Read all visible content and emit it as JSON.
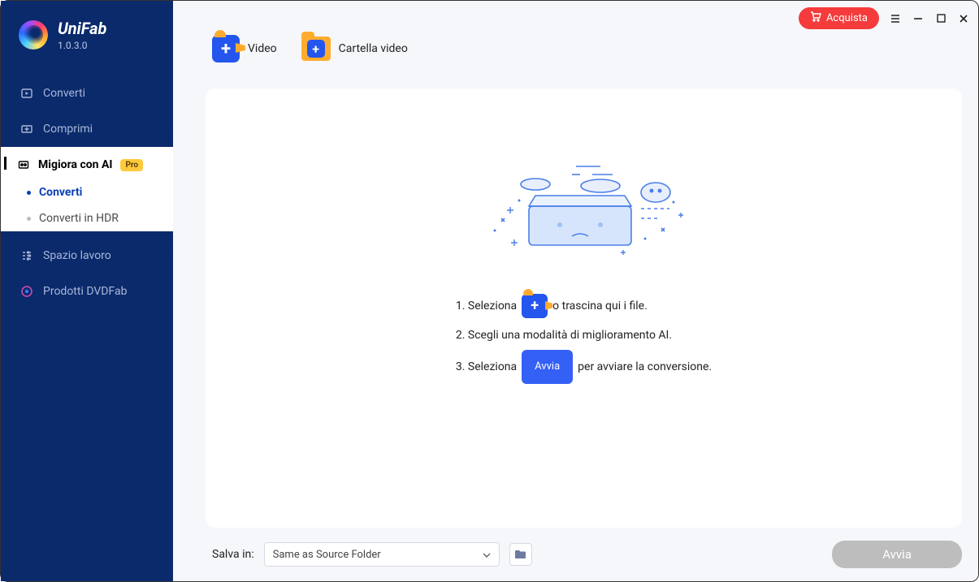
{
  "brand": {
    "name": "UniFab",
    "version": "1.0.3.0"
  },
  "titlebar": {
    "buy": "Acquista"
  },
  "sidebar": {
    "convert": "Converti",
    "compress": "Comprimi",
    "enhance": "Migiora con AI",
    "pro": "Pro",
    "sub_convert": "Converti",
    "sub_hdr": "Converti in HDR",
    "workspace": "Spazio lavoro",
    "products": "Prodotti DVDFab"
  },
  "add": {
    "video": "Video",
    "folder": "Cartella video"
  },
  "instructions": {
    "l1a": "1. Seleziona",
    "l1b": "o trascina qui i file.",
    "l2": "2. Scegli una modalità di miglioramento AI.",
    "l3a": "3. Seleziona",
    "avvia": "Avvia",
    "l3b": "per avviare la conversione."
  },
  "footer": {
    "save_label": "Salva in:",
    "save_value": "Same as Source Folder",
    "start": "Avvia"
  }
}
